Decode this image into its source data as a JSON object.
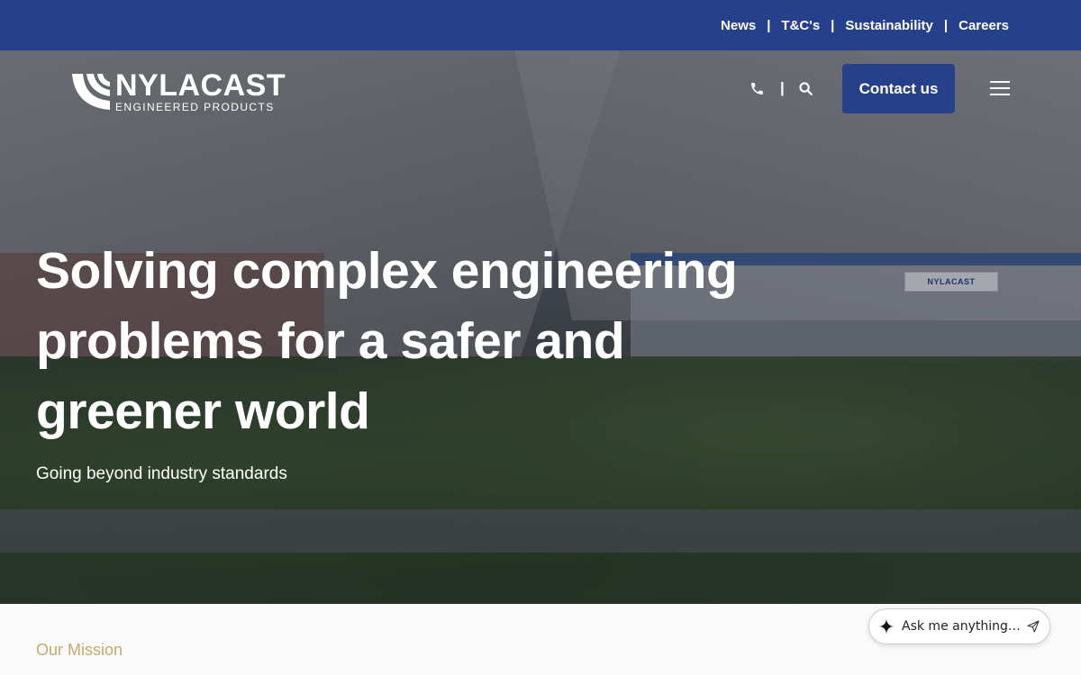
{
  "topbar": {
    "links": [
      "News",
      "T&C's",
      "Sustainability",
      "Careers"
    ],
    "separator": "|"
  },
  "logo": {
    "brand": "NYLACAST",
    "tagline": "ENGINEERED PRODUCTS"
  },
  "nav": {
    "separator": "|",
    "contact_label": "Contact us",
    "icons": [
      "phone-icon",
      "search-icon",
      "hamburger-menu-icon"
    ]
  },
  "hero": {
    "title_lines": [
      "Solving complex engineering",
      "problems for a safer and",
      "greener world"
    ],
    "subtitle": "Going beyond industry standards",
    "sign_text": "NYLACAST"
  },
  "mission": {
    "label": "Our Mission"
  },
  "chat": {
    "placeholder": "Ask me anything…",
    "icons": [
      "sparkle-icon",
      "send-icon"
    ]
  },
  "colors": {
    "primary_blue": "#27408b",
    "mission_gold": "#c9a96a"
  }
}
